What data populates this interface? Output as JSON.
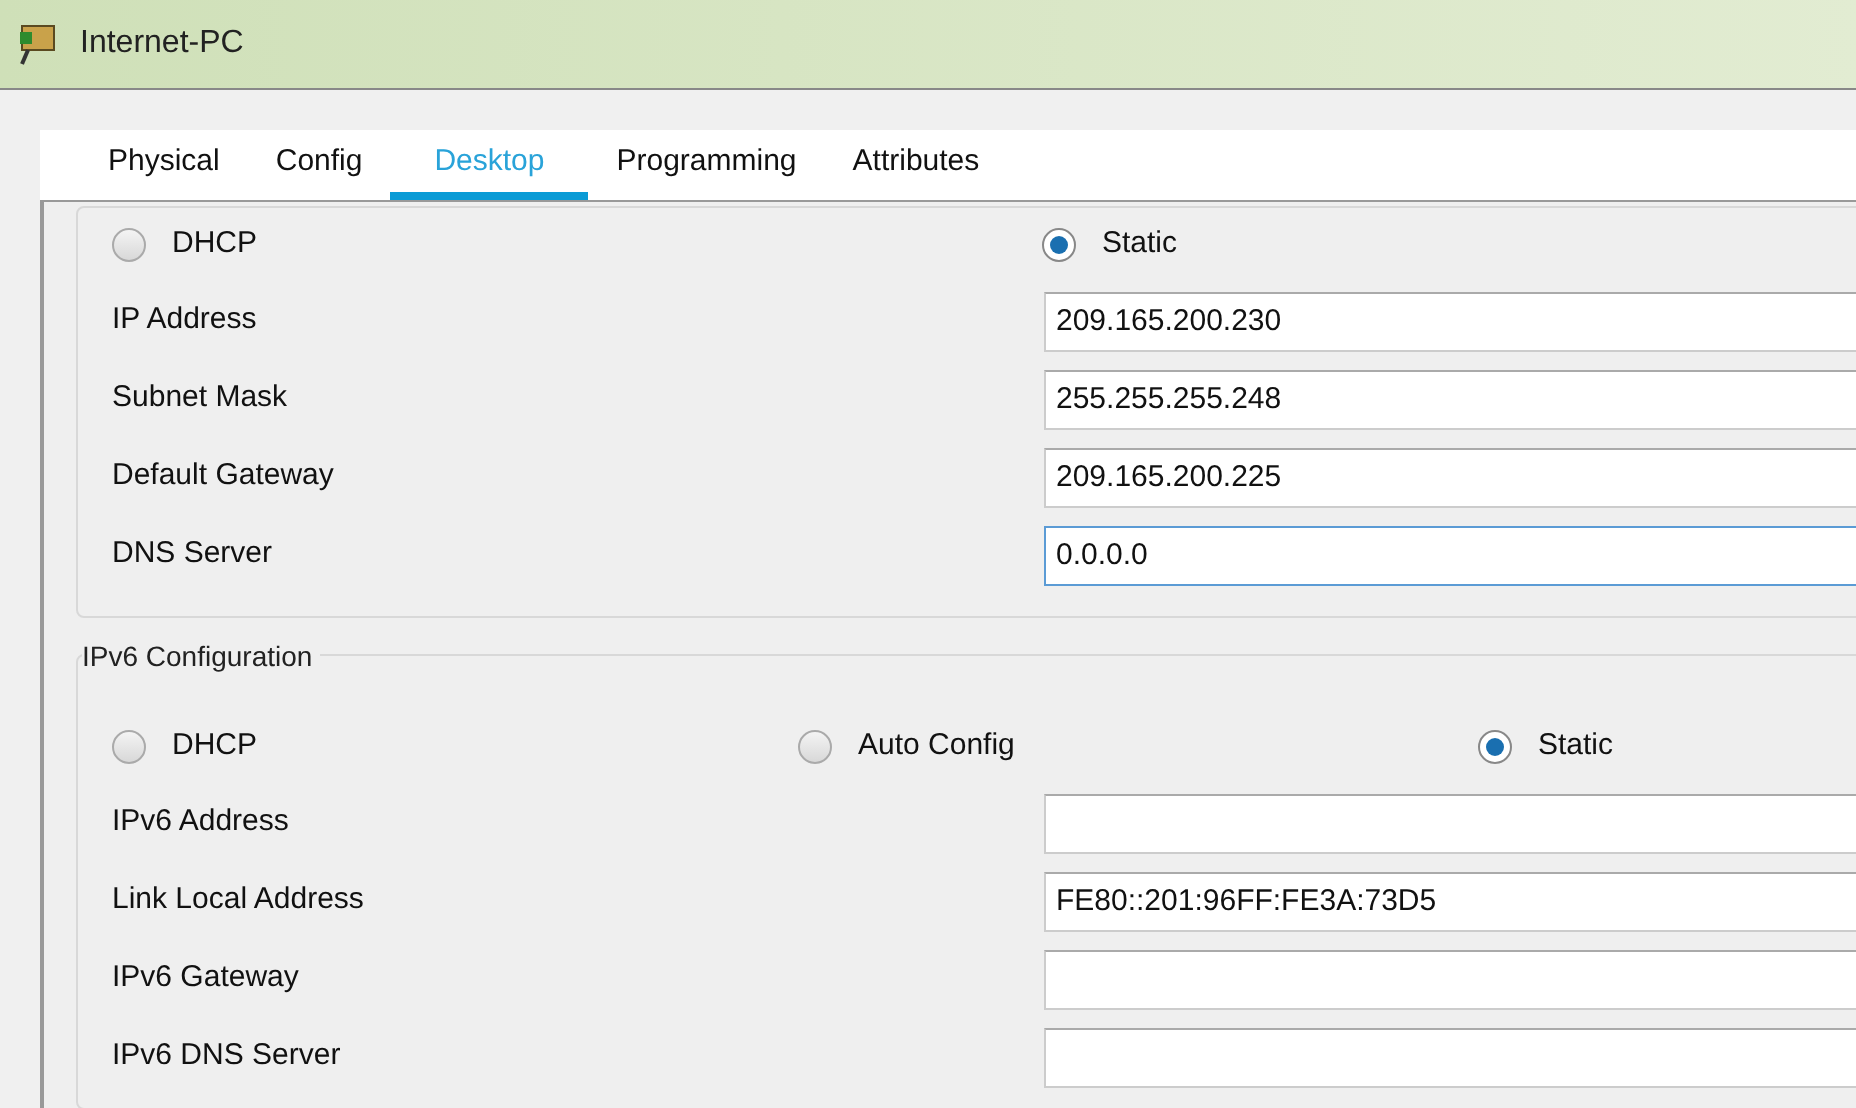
{
  "window": {
    "title": "Internet-PC"
  },
  "tabs": [
    {
      "label": "Physical",
      "selected": false
    },
    {
      "label": "Config",
      "selected": false
    },
    {
      "label": "Desktop",
      "selected": true
    },
    {
      "label": "Programming",
      "selected": false
    },
    {
      "label": "Attributes",
      "selected": false
    }
  ],
  "ipv4": {
    "modes": [
      {
        "label": "DHCP",
        "selected": false
      },
      {
        "label": "Static",
        "selected": true
      }
    ],
    "fields": [
      {
        "label": "IP Address",
        "value": "209.165.200.230",
        "focused": false
      },
      {
        "label": "Subnet Mask",
        "value": "255.255.255.248",
        "focused": false
      },
      {
        "label": "Default Gateway",
        "value": "209.165.200.225",
        "focused": false
      },
      {
        "label": "DNS Server",
        "value": "0.0.0.0",
        "focused": true
      }
    ]
  },
  "ipv6": {
    "title": "IPv6 Configuration",
    "modes": [
      {
        "label": "DHCP",
        "selected": false
      },
      {
        "label": "Auto Config",
        "selected": false
      },
      {
        "label": "Static",
        "selected": true
      }
    ],
    "fields": [
      {
        "label": "IPv6 Address",
        "focused": false
      },
      {
        "label": "Link Local Address",
        "value": "FE80::201:96FF:FE3A:73D5",
        "focused": false
      },
      {
        "label": "IPv6 Gateway",
        "focused": false
      },
      {
        "label": "IPv6 DNS Server",
        "focused": false
      }
    ]
  }
}
